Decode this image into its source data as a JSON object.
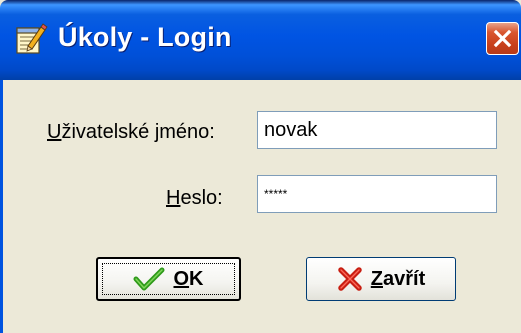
{
  "window": {
    "title": "Úkoly - Login",
    "title_icon": "notepad-pencil-icon",
    "close_icon": "close-icon"
  },
  "form": {
    "username": {
      "label_accel": "U",
      "label_rest": "živatelské jméno:",
      "value": "novak"
    },
    "password": {
      "label_accel": "H",
      "label_rest": "eslo:",
      "value": "*****"
    }
  },
  "buttons": {
    "ok": {
      "label_accel": "O",
      "label_rest": "K",
      "icon": "check-icon"
    },
    "close": {
      "label_accel": "Z",
      "label_rest": "avřít",
      "icon": "x-icon"
    }
  },
  "colors": {
    "titlebar": "#0054e3",
    "dialog_bg": "#ece9d8",
    "close_button": "#d9562f",
    "check_icon": "#2e9a1a",
    "x_icon": "#c81e12"
  }
}
